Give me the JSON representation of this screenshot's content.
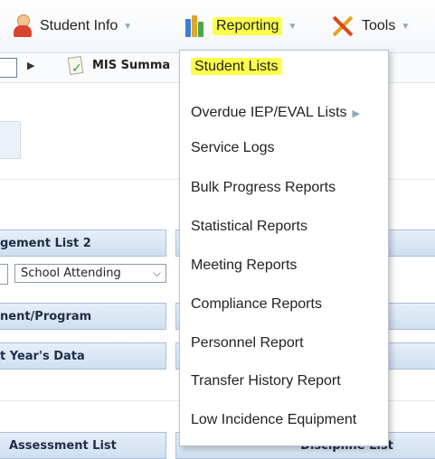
{
  "nav": {
    "student_info": "Student Info",
    "reporting": "Reporting",
    "tools": "Tools"
  },
  "toolbar": {
    "mis_summary": "MIS Summa"
  },
  "sections": {
    "management_list": "gement List 2",
    "school_attending": "School Attending",
    "placement_program": "nent/Program",
    "prior_year": "t Year's Data",
    "assessment_list": "Assessment List",
    "discipline_list": "Discipline List"
  },
  "reporting_menu": {
    "items": [
      "Student Lists",
      "Overdue IEP/EVAL Lists",
      "Service Logs",
      "Bulk Progress Reports",
      "Statistical Reports",
      "Meeting Reports",
      "Compliance Reports",
      "Personnel Report",
      "Transfer History Report",
      "Low Incidence Equipment"
    ]
  },
  "colors": {
    "highlight": "#fbff4a",
    "header_blue": "#cfdff0",
    "caret_blue": "#8aa6c8"
  }
}
